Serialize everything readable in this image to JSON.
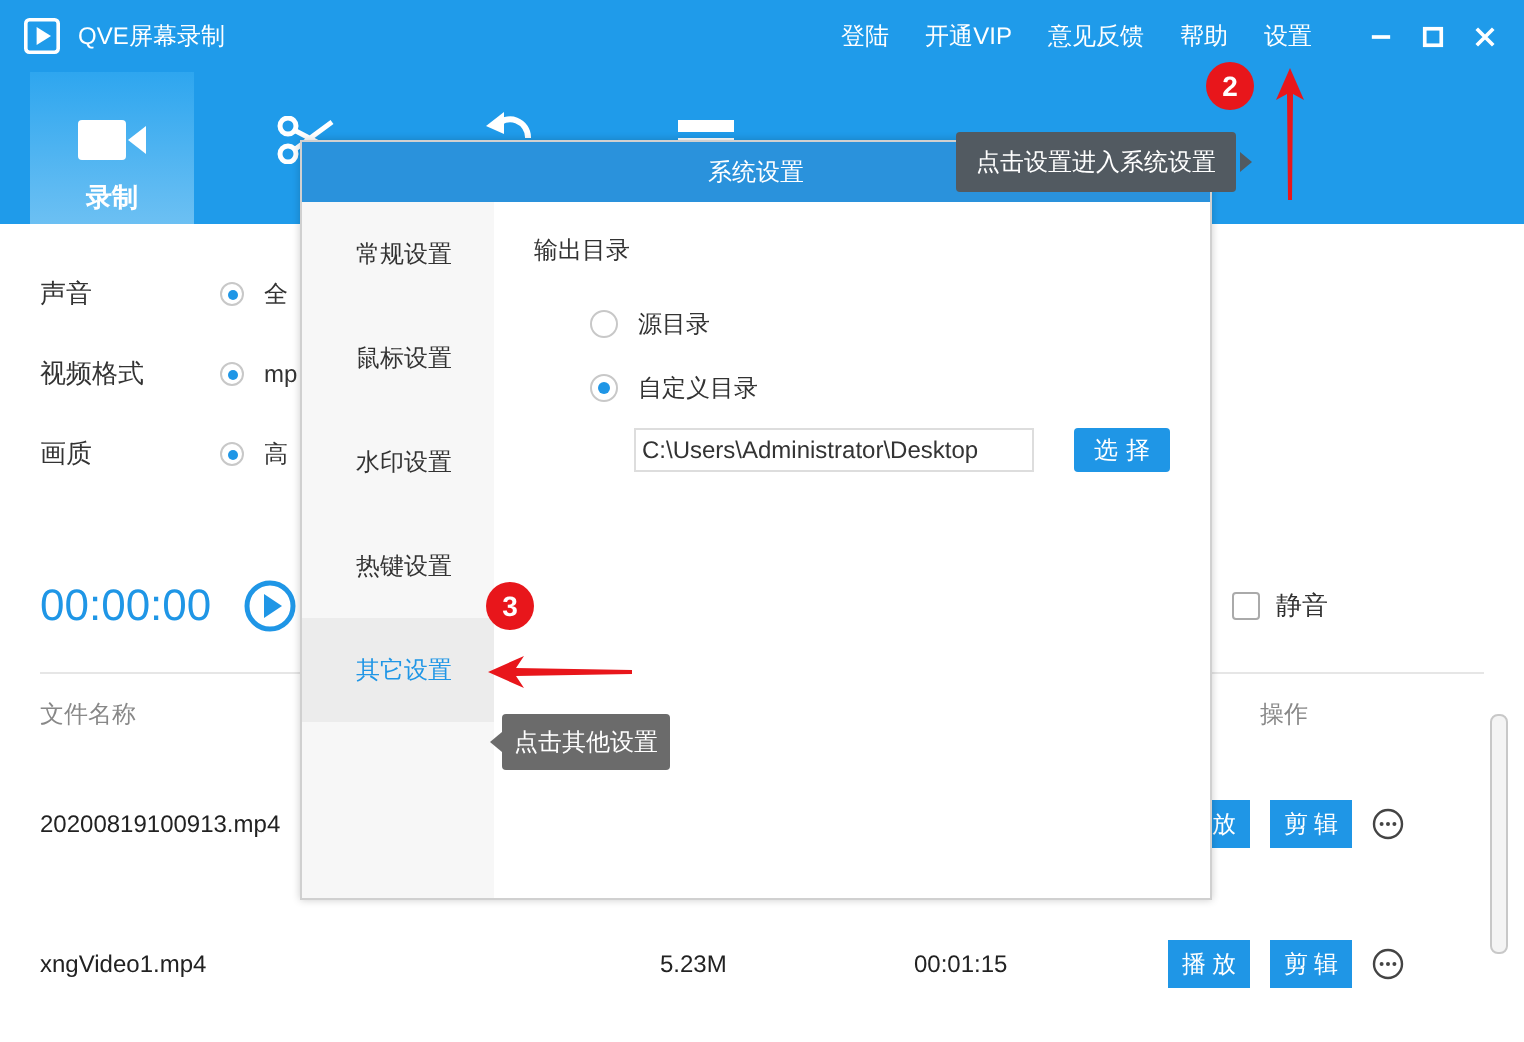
{
  "window": {
    "title": "QVE屏幕录制"
  },
  "top_links": [
    "登陆",
    "开通VIP",
    "意见反馈",
    "帮助",
    "设置"
  ],
  "tabs": [
    {
      "label": "录制",
      "selected": true
    },
    {
      "selected": false
    },
    {
      "selected": false
    },
    {
      "selected": false
    }
  ],
  "settings": [
    {
      "label": "声音",
      "option": "全",
      "selected": true
    },
    {
      "label": "视频格式",
      "option": "mp",
      "selected": true
    },
    {
      "label": "画质",
      "option": "高",
      "selected": true
    }
  ],
  "timer": "00:00:00",
  "mute": {
    "label": "静音",
    "checked": false
  },
  "table": {
    "columns": [
      "文件名称",
      "操作"
    ],
    "rows": [
      {
        "name": "20200819100913.mp4",
        "actions": [
          "放",
          "剪辑"
        ]
      },
      {
        "name": "xngVideo1.mp4",
        "size": "5.23M",
        "duration": "00:01:15",
        "actions": [
          "播放",
          "剪辑"
        ]
      }
    ]
  },
  "dialog": {
    "title": "系统设置",
    "nav": [
      {
        "label": "常规设置",
        "selected": false
      },
      {
        "label": "鼠标设置",
        "selected": false
      },
      {
        "label": "水印设置",
        "selected": false
      },
      {
        "label": "热键设置",
        "selected": false
      },
      {
        "label": "其它设置",
        "selected": true
      }
    ],
    "section_title": "输出目录",
    "options": [
      {
        "label": "源目录",
        "selected": false
      },
      {
        "label": "自定义目录",
        "selected": true
      }
    ],
    "path": "C:\\Users\\Administrator\\Desktop",
    "choose_button": "选择"
  },
  "callouts": [
    {
      "number": "2",
      "tip": "点击设置进入系统设置"
    },
    {
      "number": "3",
      "tip": "点击其他设置"
    }
  ]
}
